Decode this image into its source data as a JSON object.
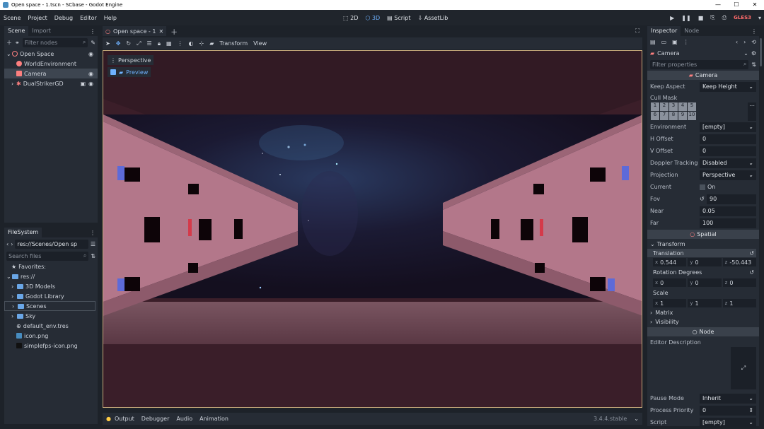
{
  "window": {
    "title": "Open space - 1.tscn - SCbase - Godot Engine",
    "controls": [
      "—",
      "☐",
      "✕"
    ]
  },
  "menu": [
    "Scene",
    "Project",
    "Debug",
    "Editor",
    "Help"
  ],
  "workspaces": {
    "d2": "2D",
    "d3": "3D",
    "script": "Script",
    "assetlib": "AssetLib"
  },
  "renderer": "GLES3",
  "scene_panel": {
    "tabs": [
      "Scene",
      "Import"
    ],
    "filter_placeholder": "Filter nodes",
    "tree": [
      {
        "label": "Open Space"
      },
      {
        "label": "WorldEnvironment"
      },
      {
        "label": "Camera"
      },
      {
        "label": "DualStrikerGD"
      }
    ]
  },
  "filesystem": {
    "tab": "FileSystem",
    "path": "res://Scenes/Open sp",
    "search_placeholder": "Search files",
    "items": {
      "favorites": "Favorites:",
      "res": "res://",
      "f1": "3D Models",
      "f2": "Godot Library",
      "f3": "Scenes",
      "f4": "Sky",
      "f5": "default_env.tres",
      "f6": "icon.png",
      "f7": "simplefps-icon.png"
    }
  },
  "editor_tab": {
    "label": "Open space - 1"
  },
  "viewport_toolbar": {
    "transform": "Transform",
    "view": "View"
  },
  "viewport": {
    "perspective": "Perspective",
    "preview": "Preview"
  },
  "bottom": {
    "output": "Output",
    "debugger": "Debugger",
    "audio": "Audio",
    "animation": "Animation",
    "version": "3.4.4.stable"
  },
  "inspector": {
    "tabs": [
      "Inspector",
      "Node"
    ],
    "node_name": "Camera",
    "filter_placeholder": "Filter properties",
    "section_camera": "Camera",
    "keep_aspect": {
      "label": "Keep Aspect",
      "value": "Keep Height"
    },
    "cull_mask": {
      "label": "Cull Mask",
      "bits": [
        "1",
        "2",
        "3",
        "4",
        "5",
        "6",
        "7",
        "8",
        "9",
        "10"
      ]
    },
    "environment": {
      "label": "Environment",
      "value": "[empty]"
    },
    "h_offset": {
      "label": "H Offset",
      "value": "0"
    },
    "v_offset": {
      "label": "V Offset",
      "value": "0"
    },
    "doppler": {
      "label": "Doppler Tracking",
      "value": "Disabled"
    },
    "projection": {
      "label": "Projection",
      "value": "Perspective"
    },
    "current": {
      "label": "Current",
      "value": "On"
    },
    "fov": {
      "label": "Fov",
      "value": "90"
    },
    "near": {
      "label": "Near",
      "value": "0.05"
    },
    "far": {
      "label": "Far",
      "value": "100"
    },
    "section_spatial": "Spatial",
    "transform_group": "Transform",
    "translation": {
      "label": "Translation",
      "x": "0.544",
      "y": "0",
      "z": "-50.443"
    },
    "rotation": {
      "label": "Rotation Degrees",
      "x": "0",
      "y": "0",
      "z": "0"
    },
    "scale": {
      "label": "Scale",
      "x": "1",
      "y": "1",
      "z": "1"
    },
    "matrix": "Matrix",
    "visibility": "Visibility",
    "section_node": "Node",
    "editor_description": "Editor Description",
    "pause_mode": {
      "label": "Pause Mode",
      "value": "Inherit"
    },
    "process_priority": {
      "label": "Process Priority",
      "value": "0"
    },
    "script": {
      "label": "Script",
      "value": "[empty]"
    },
    "axis": {
      "x": "x",
      "y": "y",
      "z": "z"
    }
  }
}
